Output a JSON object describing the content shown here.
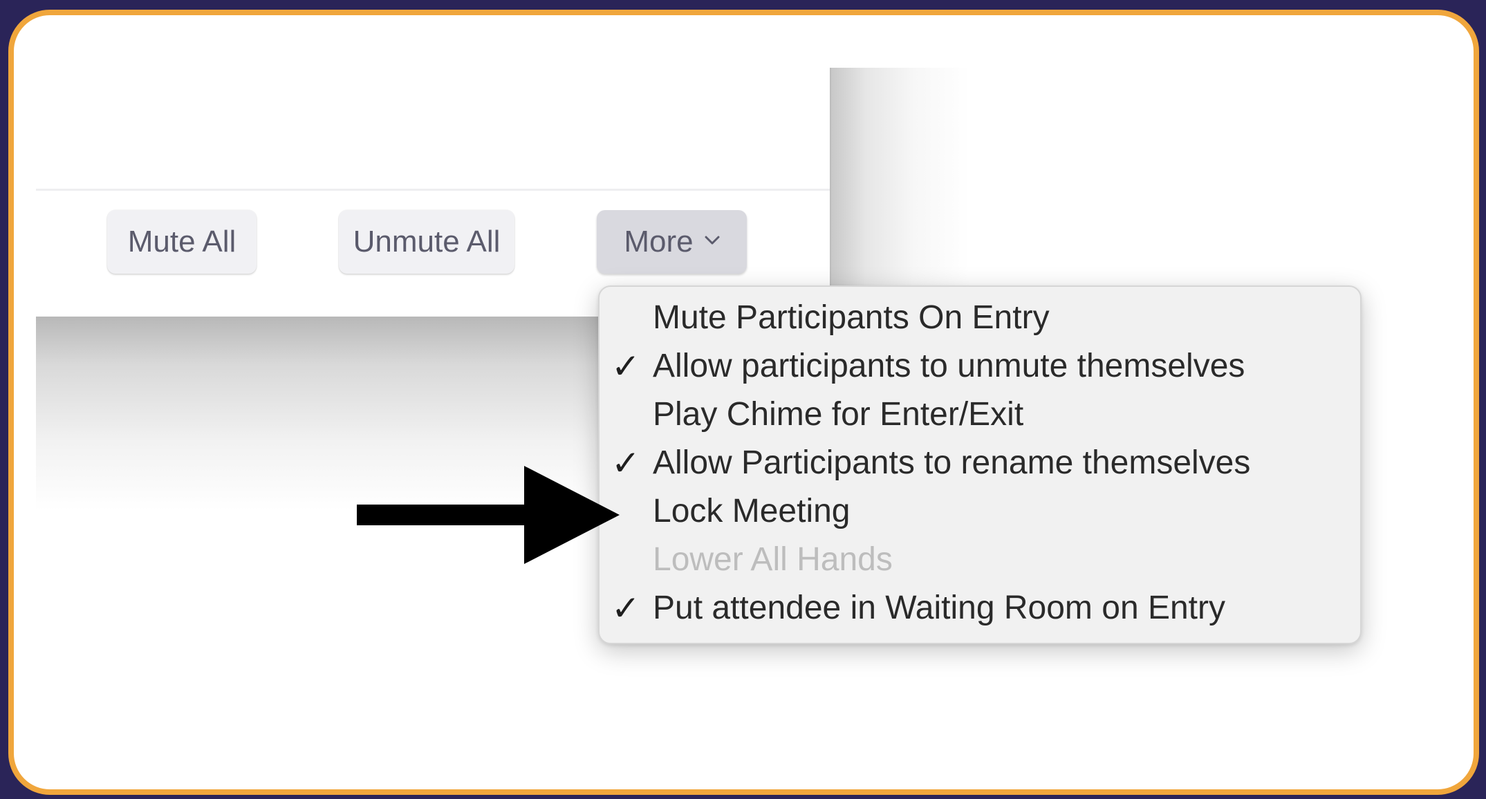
{
  "toolbar": {
    "mute_all_label": "Mute All",
    "unmute_all_label": "Unmute All",
    "more_label": "More"
  },
  "menu": {
    "items": [
      {
        "label": "Mute Participants On Entry",
        "checked": false,
        "check_glyph": "",
        "enabled": true
      },
      {
        "label": "Allow participants to unmute themselves",
        "checked": true,
        "check_glyph": "✓",
        "enabled": true
      },
      {
        "label": "Play Chime for Enter/Exit",
        "checked": false,
        "check_glyph": "",
        "enabled": true
      },
      {
        "label": "Allow Participants to rename themselves",
        "checked": true,
        "check_glyph": "✓",
        "enabled": true
      },
      {
        "label": "Lock Meeting",
        "checked": false,
        "check_glyph": "",
        "enabled": true
      },
      {
        "label": "Lower All Hands",
        "checked": false,
        "check_glyph": "",
        "enabled": false
      },
      {
        "label": "Put attendee in Waiting Room on Entry",
        "checked": true,
        "check_glyph": "✓",
        "enabled": true
      }
    ]
  },
  "annotation": {
    "icon": "arrow-right-icon",
    "color": "#000000"
  },
  "colors": {
    "frame_border": "#f0a63c",
    "outer_background": "#2a2458",
    "menu_background": "#f1f1f1",
    "disabled_text": "#bdbdbd"
  }
}
